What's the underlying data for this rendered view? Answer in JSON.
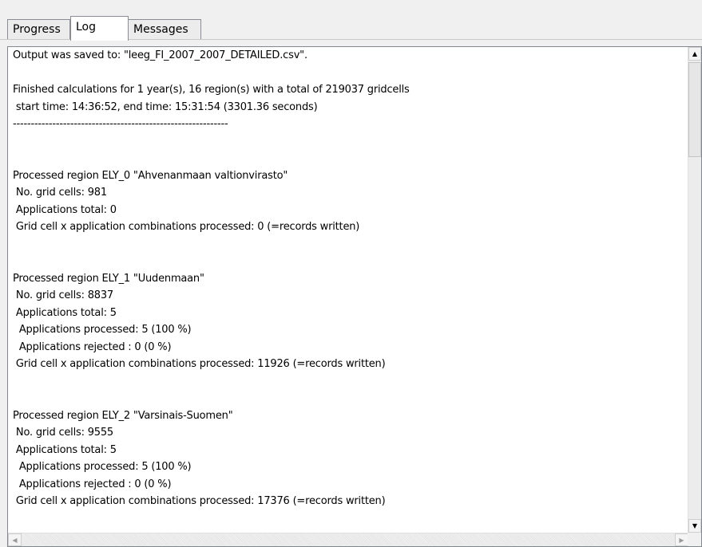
{
  "tabs": {
    "progress": "Progress",
    "log": "Log",
    "messages": "Messages"
  },
  "log_lines": [
    "Output was saved to: \"leeg_FI_2007_2007_DETAILED.csv\".",
    "",
    "Finished calculations for 1 year(s), 16 region(s) with a total of 219037 gridcells",
    " start time: 14:36:52, end time: 15:31:54 (3301.36 seconds)",
    "------------------------------------------------------------",
    "",
    "",
    "Processed region ELY_0 \"Ahvenanmaan valtionvirasto\"",
    " No. grid cells: 981",
    " Applications total: 0",
    " Grid cell x application combinations processed: 0 (=records written)",
    "",
    "",
    "Processed region ELY_1 \"Uudenmaan\"",
    " No. grid cells: 8837",
    " Applications total: 5",
    "  Applications processed: 5 (100 %)",
    "  Applications rejected : 0 (0 %)",
    " Grid cell x application combinations processed: 11926 (=records written)",
    "",
    "",
    "Processed region ELY_2 \"Varsinais-Suomen\"",
    " No. grid cells: 9555",
    " Applications total: 5",
    "  Applications processed: 5 (100 %)",
    "  Applications rejected : 0 (0 %)",
    " Grid cell x application combinations processed: 17376 (=records written)"
  ],
  "icons": {
    "scroll_up": "up-arrow",
    "scroll_down": "down-arrow",
    "scroll_left": "left-arrow",
    "scroll_right": "right-arrow"
  }
}
